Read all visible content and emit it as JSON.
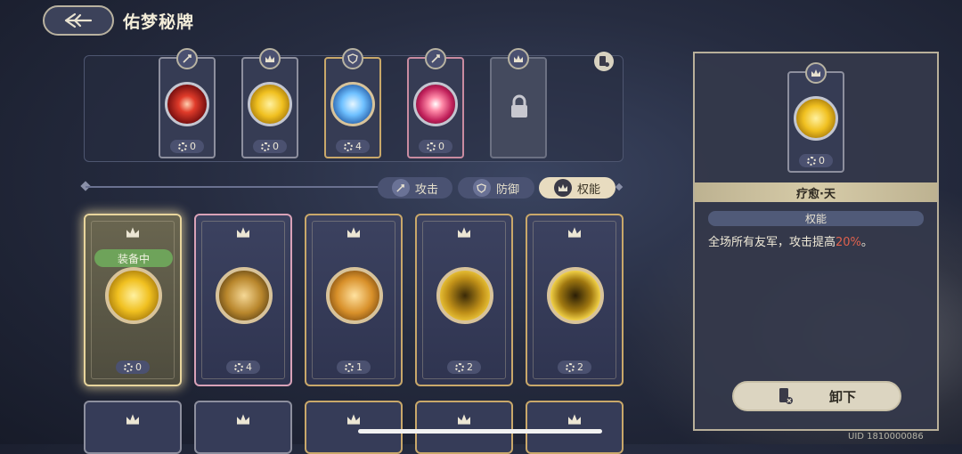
{
  "header": {
    "title": "佑梦秘牌"
  },
  "equipped_slots": [
    {
      "type": "attack",
      "count": "0",
      "art": "red-burst",
      "frame": "gray"
    },
    {
      "type": "authority",
      "count": "0",
      "art": "gold-figure",
      "frame": "gray"
    },
    {
      "type": "defense",
      "count": "4",
      "art": "ice-crystal",
      "frame": "gold"
    },
    {
      "type": "attack",
      "count": "0",
      "art": "pink-burst",
      "frame": "pink"
    },
    {
      "type": "authority",
      "locked": true
    }
  ],
  "tabs": [
    {
      "label": "攻击",
      "icon": "sword-icon"
    },
    {
      "label": "防御",
      "icon": "shield-icon"
    },
    {
      "label": "权能",
      "icon": "crown-icon",
      "active": true
    }
  ],
  "cards": [
    {
      "count": "0",
      "art": "gold-figure",
      "equipped": true,
      "frame": "selected"
    },
    {
      "count": "4",
      "art": "gold-gear",
      "frame": "pink"
    },
    {
      "count": "1",
      "art": "gold-runner",
      "frame": "gold"
    },
    {
      "count": "2",
      "art": "gold-fist",
      "frame": "gold"
    },
    {
      "count": "2",
      "art": "gold-statue",
      "frame": "gold"
    }
  ],
  "equipped_badge": "装备中",
  "detail": {
    "name": "疗愈·天",
    "type": "权能",
    "count": "0",
    "description_prefix": "全场所有友军，攻击提高",
    "description_value": "20%",
    "description_suffix": "。",
    "unequip_label": "卸下"
  },
  "uid": "UID 1810000086",
  "colors": {
    "highlight": "#e0624e",
    "gold_frame": "#c9a86a",
    "equipped_green": "#6ea35a"
  }
}
